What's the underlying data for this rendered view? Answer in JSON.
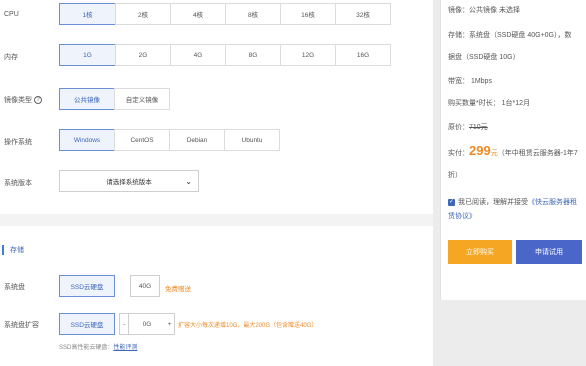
{
  "cpu": {
    "label": "CPU",
    "options": [
      "1核",
      "2核",
      "4核",
      "8核",
      "16核",
      "32核"
    ]
  },
  "memory": {
    "label": "内存",
    "options": [
      "1G",
      "2G",
      "4G",
      "8G",
      "12G",
      "16G"
    ]
  },
  "image_type": {
    "label": "镜像类型",
    "help": "?",
    "options": [
      "公共镜像",
      "自定义镜像"
    ]
  },
  "os": {
    "label": "操作系统",
    "options": [
      "Windows",
      "CentOS",
      "Debian",
      "Ubuntu"
    ]
  },
  "os_version": {
    "label": "系统版本",
    "select": "请选择系统版本",
    "chevron": "⌄"
  },
  "storage": {
    "title": "存储",
    "system_disk": {
      "label": "系统盘",
      "type": "SSD云硬盘",
      "size": "40G",
      "free": "免费赠送"
    },
    "expand": {
      "label": "系统盘扩容",
      "type": "SSD云硬盘",
      "minus": "-",
      "value": "0G",
      "plus": "+",
      "hint": "扩容大小每次递增10G，最大200G（包含赠送40G）"
    },
    "perf_prefix": "SSD高性能云硬盘：",
    "perf_link": "性能评测"
  },
  "summary": {
    "image": "镜像：公共镜像 未选择",
    "storage_line1": "存储：系统盘（SSD硬盘 40G+0G），数",
    "storage_line2": "据盘（SSD硬盘 10G）",
    "bandwidth": "带宽：  1Mbps",
    "quantity": "购买数量*时长：  1台*12月",
    "orig_label": "原价：",
    "orig_price": "710元",
    "paid_label": "实付：",
    "price": "299",
    "price_unit": "元",
    "price_note": "（年中租赁云服务器-1年7",
    "price_note2": "折）",
    "agree_prefix": "我已阅读，理解并接受",
    "agree_link1": "《快云服务器租",
    "agree_link2": "赁协议》",
    "buy_label": "立即购买",
    "trial_label": "申请试用"
  },
  "colors": {
    "accent": "#3d67b8",
    "orange": "#f08a24",
    "buy": "#f5a623",
    "trial": "#4a66c9"
  }
}
